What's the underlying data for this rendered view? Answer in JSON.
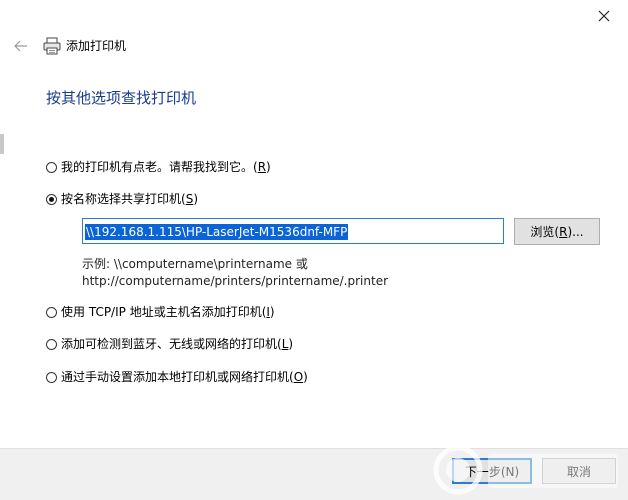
{
  "window": {
    "title": "添加打印机",
    "close_icon": "close-icon",
    "back_icon": "back-arrow-icon",
    "printer_icon": "printer-icon"
  },
  "heading": "按其他选项查找打印机",
  "options": [
    {
      "label": "我的打印机有点老。请帮我找到它。(",
      "key": "R",
      "suffix": ")",
      "checked": false
    },
    {
      "label": "按名称选择共享打印机(",
      "key": "S",
      "suffix": ")",
      "checked": true
    },
    {
      "label": "使用 TCP/IP 地址或主机名添加打印机(",
      "key": "I",
      "suffix": ")",
      "checked": false
    },
    {
      "label": "添加可检测到蓝牙、无线或网络的打印机(",
      "key": "L",
      "suffix": ")",
      "checked": false
    },
    {
      "label": "通过手动设置添加本地打印机或网络打印机(",
      "key": "O",
      "suffix": ")",
      "checked": false
    }
  ],
  "shared_printer": {
    "value": "\\\\192.168.1.115\\HP-LaserJet-M1536dnf-MFP",
    "browse_label": "浏览(",
    "browse_key": "R",
    "browse_suffix": ")...",
    "example_line1": "示例: \\\\computername\\printername 或",
    "example_line2": "http://computername/printers/printername/.printer"
  },
  "footer": {
    "next_label": "下一步(N)",
    "cancel_label": "取消"
  },
  "colors": {
    "heading": "#1a3c8c",
    "focus_border": "#2e7cd1",
    "selection": "#0a64d6",
    "button_bg": "#e1e1e1"
  }
}
